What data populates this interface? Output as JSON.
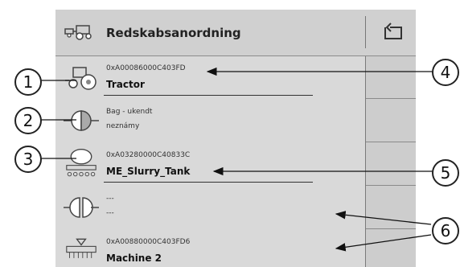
{
  "header": {
    "title": "Redskabsanordning"
  },
  "rows": [
    {
      "id": "0xA00086000C403FD",
      "name": "Tractor"
    },
    {
      "line1": "Bag - ukendt",
      "line2": "neznámy"
    },
    {
      "id": "0xA03280000C40833C",
      "name": "ME_Slurry_Tank"
    },
    {
      "line1": "---",
      "line2": "---"
    },
    {
      "id": "0xA00880000C403FD6",
      "name": "Machine 2"
    }
  ],
  "callouts": [
    "1",
    "2",
    "3",
    "4",
    "5",
    "6"
  ],
  "icons": [
    "tractor-implement-icon",
    "back-arrow-icon",
    "tractor-icon",
    "connector-icon",
    "slurry-tank-icon",
    "coupling-icon",
    "machine-icon"
  ]
}
